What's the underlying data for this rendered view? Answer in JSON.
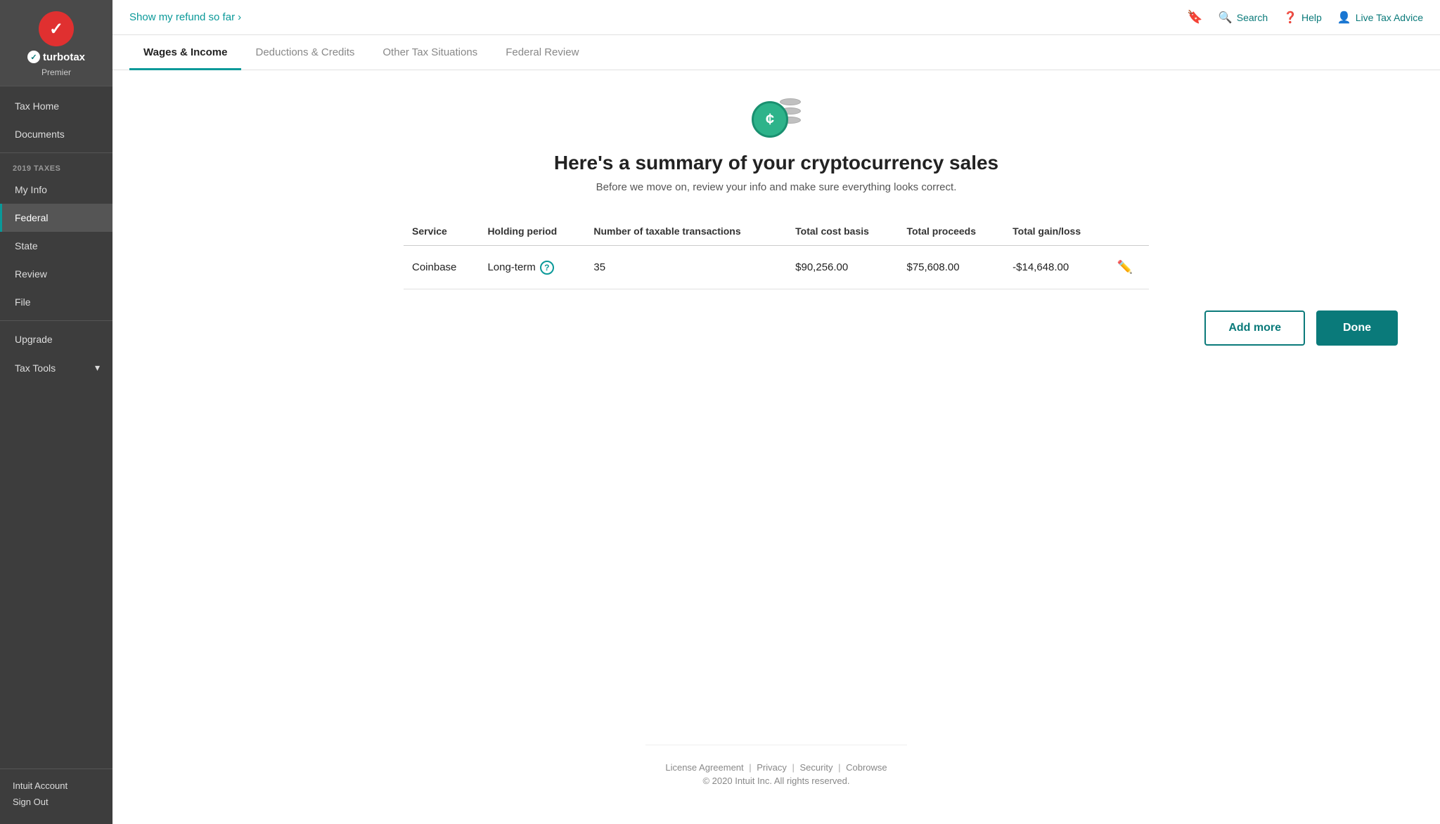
{
  "sidebar": {
    "logo_check": "✓",
    "brand_icon": "✓",
    "brand_name": "turbotax",
    "brand_tier": "Premier",
    "nav_items": [
      {
        "id": "tax-home",
        "label": "Tax Home",
        "active": false
      },
      {
        "id": "documents",
        "label": "Documents",
        "active": false
      }
    ],
    "section_label": "2019 TAXES",
    "tax_items": [
      {
        "id": "my-info",
        "label": "My Info",
        "active": false
      },
      {
        "id": "federal",
        "label": "Federal",
        "active": true
      },
      {
        "id": "state",
        "label": "State",
        "active": false
      },
      {
        "id": "review",
        "label": "Review",
        "active": false
      },
      {
        "id": "file",
        "label": "File",
        "active": false
      }
    ],
    "extra_items": [
      {
        "id": "upgrade",
        "label": "Upgrade",
        "arrow": false
      },
      {
        "id": "tax-tools",
        "label": "Tax Tools",
        "arrow": true
      }
    ],
    "bottom_links": [
      {
        "id": "intuit-account",
        "label": "Intuit Account"
      },
      {
        "id": "sign-out",
        "label": "Sign Out"
      }
    ]
  },
  "topbar": {
    "refund_text": "Show my refund so far",
    "refund_arrow": "›",
    "search_label": "Search",
    "help_label": "Help",
    "live_tax_label": "Live Tax Advice"
  },
  "tabs": [
    {
      "id": "wages-income",
      "label": "Wages & Income",
      "active": true
    },
    {
      "id": "deductions-credits",
      "label": "Deductions & Credits",
      "active": false
    },
    {
      "id": "other-tax-situations",
      "label": "Other Tax Situations",
      "active": false
    },
    {
      "id": "federal-review",
      "label": "Federal Review",
      "active": false
    }
  ],
  "page": {
    "title": "Here's a summary of your cryptocurrency sales",
    "subtitle": "Before we move on, review your info and make sure everything looks correct.",
    "coin_symbol": "¢"
  },
  "table": {
    "headers": [
      {
        "id": "service",
        "label": "Service"
      },
      {
        "id": "holding-period",
        "label": "Holding period"
      },
      {
        "id": "taxable-transactions",
        "label": "Number of taxable transactions"
      },
      {
        "id": "cost-basis",
        "label": "Total cost basis"
      },
      {
        "id": "proceeds",
        "label": "Total proceeds"
      },
      {
        "id": "gain-loss",
        "label": "Total gain/loss"
      },
      {
        "id": "actions",
        "label": ""
      }
    ],
    "rows": [
      {
        "service": "Coinbase",
        "holding_period": "Long-term",
        "transactions": "35",
        "cost_basis": "$90,256.00",
        "proceeds": "$75,608.00",
        "gain_loss": "-$14,648.00"
      }
    ]
  },
  "buttons": {
    "add_more": "Add more",
    "done": "Done"
  },
  "footer": {
    "links": [
      "License Agreement",
      "Privacy",
      "Security",
      "Cobrowse"
    ],
    "copyright": "© 2020 Intuit Inc. All rights reserved."
  }
}
